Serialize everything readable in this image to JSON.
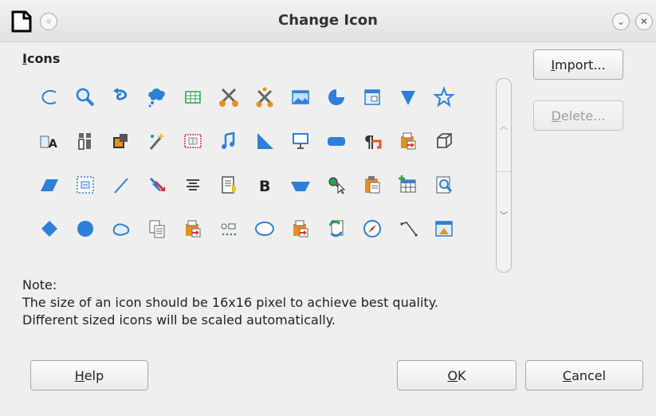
{
  "window": {
    "title": "Change Icon",
    "minimize_glyph": "⌄",
    "close_glyph": "✕"
  },
  "icons_label": {
    "mnemonic": "I",
    "rest": "cons"
  },
  "icons": [
    "arc-icon",
    "zoom-icon",
    "undo-icon",
    "callout-cloud-icon",
    "table-icon",
    "scissors-icon",
    "cut-shape-icon",
    "picture-frame-icon",
    "pie-icon",
    "form-icon",
    "triangle-down-icon",
    "star-icon",
    "text-frame-icon",
    "align-icon",
    "bring-front-icon",
    "magic-wand-icon",
    "grid-select-icon",
    "music-icon",
    "right-triangle-icon",
    "monitor-icon",
    "rounded-rect-icon",
    "paragraph-icon",
    "paste-folder-icon",
    "cube-icon",
    "parallelogram-icon",
    "dashed-frame-icon",
    "line-icon",
    "swap-arrows-icon",
    "align-center-icon",
    "note-page-icon",
    "bold-icon",
    "trapezoid-icon",
    "zoom-pointer-icon",
    "paste-icon",
    "insert-table-icon",
    "preview-icon",
    "diamond-icon",
    "circle-icon",
    "blob-icon",
    "copy-icon",
    "paste-folder-2-icon",
    "dots-icon",
    "ellipse-icon",
    "paste-folder-3-icon",
    "refresh-icon",
    "compass-icon",
    "polyline-icon",
    "document-chart-icon"
  ],
  "buttons": {
    "import": {
      "mnemonic": "I",
      "rest": "mport..."
    },
    "delete": {
      "mnemonic": "D",
      "rest": "elete..."
    },
    "help": {
      "mnemonic": "H",
      "rest": "elp"
    },
    "ok": {
      "mnemonic": "O",
      "rest": "K"
    },
    "cancel": {
      "mnemonic": "C",
      "rest": "ancel"
    }
  },
  "note": {
    "line1": "Note:",
    "line2": "The size of an icon should be 16x16 pixel to achieve best quality.",
    "line3": "Different sized icons will be scaled automatically."
  },
  "colors": {
    "accent_blue": "#2f7fd8",
    "orange": "#e8901c"
  }
}
